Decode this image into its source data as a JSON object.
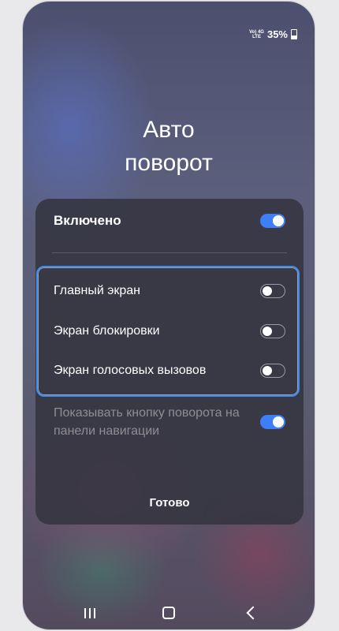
{
  "status_bar": {
    "network_top": "Vo) 4G",
    "network_bottom": "LTE",
    "battery": "35%"
  },
  "dialog": {
    "title_line1": "Авто",
    "title_line2": "поворот",
    "main_toggle": {
      "label": "Включено",
      "state": "on"
    },
    "options": [
      {
        "label": "Главный экран",
        "state": "off"
      },
      {
        "label": "Экран блокировки",
        "state": "off"
      },
      {
        "label": "Экран голосовых вызовов",
        "state": "off"
      }
    ],
    "nav_button_toggle": {
      "label": "Показывать кнопку поворота на панели навигации",
      "state": "on"
    },
    "done_label": "Готово"
  },
  "navbar": {
    "icons": [
      "recent-apps-icon",
      "home-icon",
      "back-icon"
    ]
  },
  "colors": {
    "accent": "#3e7ef6",
    "highlight_border": "#3d8cf2",
    "panel": "#343440"
  }
}
